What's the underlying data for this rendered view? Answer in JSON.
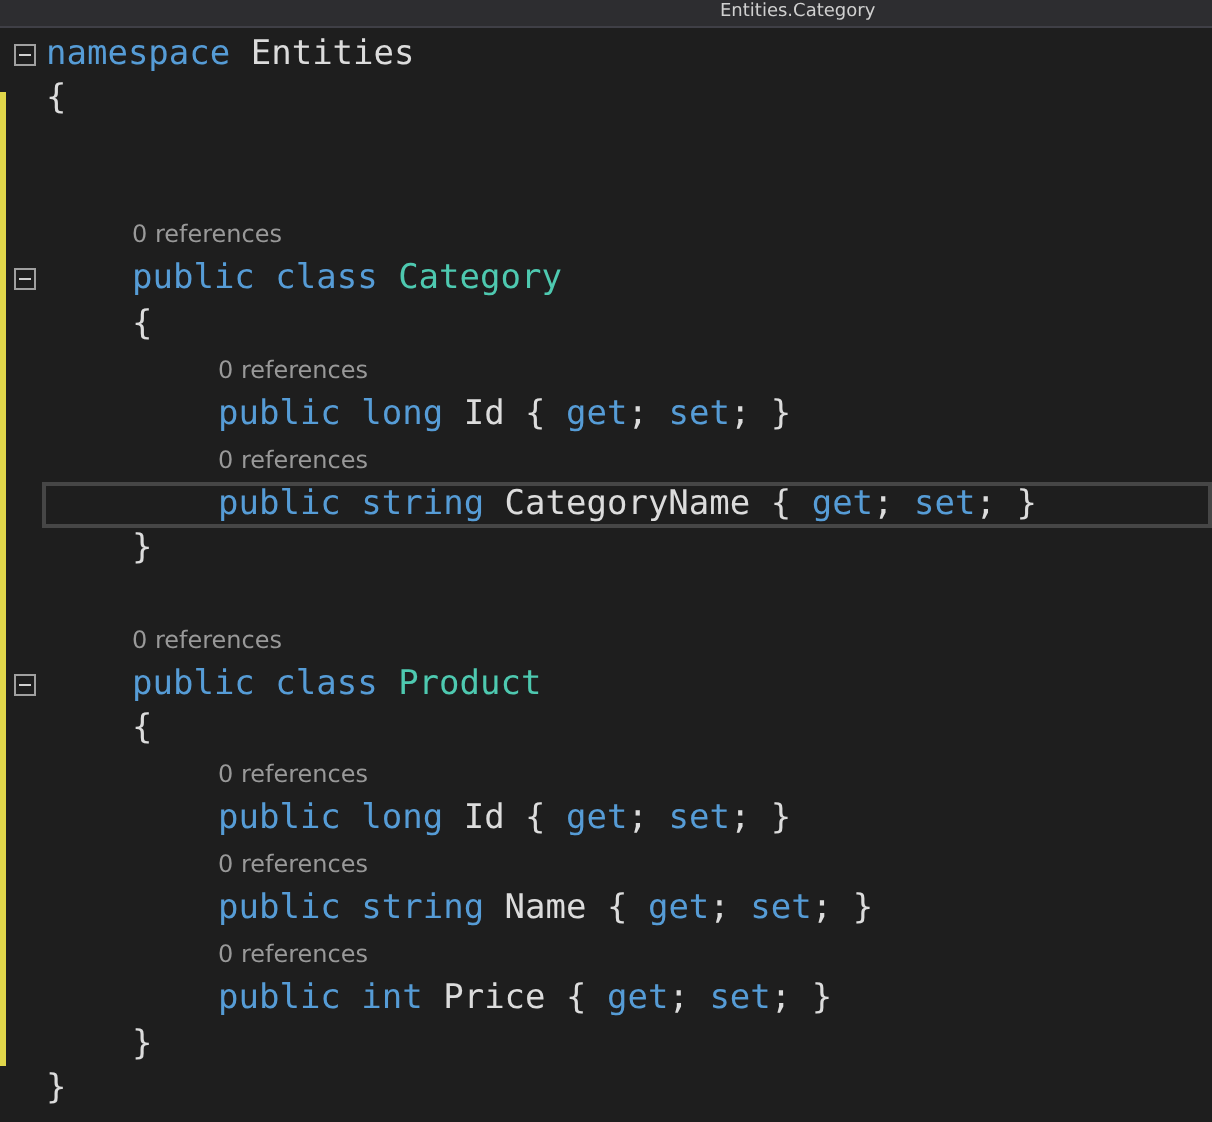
{
  "top_bar": {
    "navigation_text": "Entities.Category"
  },
  "code": [
    {
      "kind": "block",
      "expanded": true,
      "tokens": [
        {
          "t": "namespace",
          "kind": "keyword"
        },
        {
          "t": " Entities",
          "kind": "ident"
        }
      ],
      "open": "{",
      "close": "}",
      "children": [
        {
          "kind": "blank"
        },
        {
          "kind": "blank"
        },
        {
          "kind": "block",
          "lens": "0 references",
          "expanded": true,
          "tokens": [
            {
              "t": "public class",
              "kind": "keyword"
            },
            {
              "t": " Category",
              "kind": "type"
            }
          ],
          "open": "{",
          "close": "}",
          "children": [
            {
              "kind": "line",
              "lens": "0 references",
              "current": false,
              "tokens": [
                {
                  "t": "public long",
                  "kind": "keyword"
                },
                {
                  "t": " Id { ",
                  "kind": "ident"
                },
                {
                  "t": "get",
                  "kind": "keyword"
                },
                {
                  "t": "; ",
                  "kind": "ident"
                },
                {
                  "t": "set",
                  "kind": "keyword"
                },
                {
                  "t": "; }",
                  "kind": "ident"
                }
              ]
            },
            {
              "kind": "line",
              "lens": "0 references",
              "current": true,
              "tokens": [
                {
                  "t": "public string",
                  "kind": "keyword"
                },
                {
                  "t": " CategoryName { ",
                  "kind": "ident"
                },
                {
                  "t": "get",
                  "kind": "keyword"
                },
                {
                  "t": "; ",
                  "kind": "ident"
                },
                {
                  "t": "set",
                  "kind": "keyword"
                },
                {
                  "t": "; }",
                  "kind": "ident"
                }
              ]
            }
          ]
        },
        {
          "kind": "blank"
        },
        {
          "kind": "block",
          "lens": "0 references",
          "expanded": true,
          "tokens": [
            {
              "t": "public class",
              "kind": "keyword"
            },
            {
              "t": " Product",
              "kind": "type"
            }
          ],
          "open": "{",
          "close": "}",
          "children": [
            {
              "kind": "line",
              "lens": "0 references",
              "current": false,
              "tokens": [
                {
                  "t": "public long",
                  "kind": "keyword"
                },
                {
                  "t": " Id { ",
                  "kind": "ident"
                },
                {
                  "t": "get",
                  "kind": "keyword"
                },
                {
                  "t": "; ",
                  "kind": "ident"
                },
                {
                  "t": "set",
                  "kind": "keyword"
                },
                {
                  "t": "; }",
                  "kind": "ident"
                }
              ]
            },
            {
              "kind": "line",
              "lens": "0 references",
              "current": false,
              "tokens": [
                {
                  "t": "public string",
                  "kind": "keyword"
                },
                {
                  "t": " Name { ",
                  "kind": "ident"
                },
                {
                  "t": "get",
                  "kind": "keyword"
                },
                {
                  "t": "; ",
                  "kind": "ident"
                },
                {
                  "t": "set",
                  "kind": "keyword"
                },
                {
                  "t": "; }",
                  "kind": "ident"
                }
              ]
            },
            {
              "kind": "line",
              "lens": "0 references",
              "current": false,
              "tokens": [
                {
                  "t": "public int",
                  "kind": "keyword"
                },
                {
                  "t": " Price { ",
                  "kind": "ident"
                },
                {
                  "t": "get",
                  "kind": "keyword"
                },
                {
                  "t": "; ",
                  "kind": "ident"
                },
                {
                  "t": "set",
                  "kind": "keyword"
                },
                {
                  "t": "; }",
                  "kind": "ident"
                }
              ]
            }
          ]
        }
      ]
    }
  ]
}
